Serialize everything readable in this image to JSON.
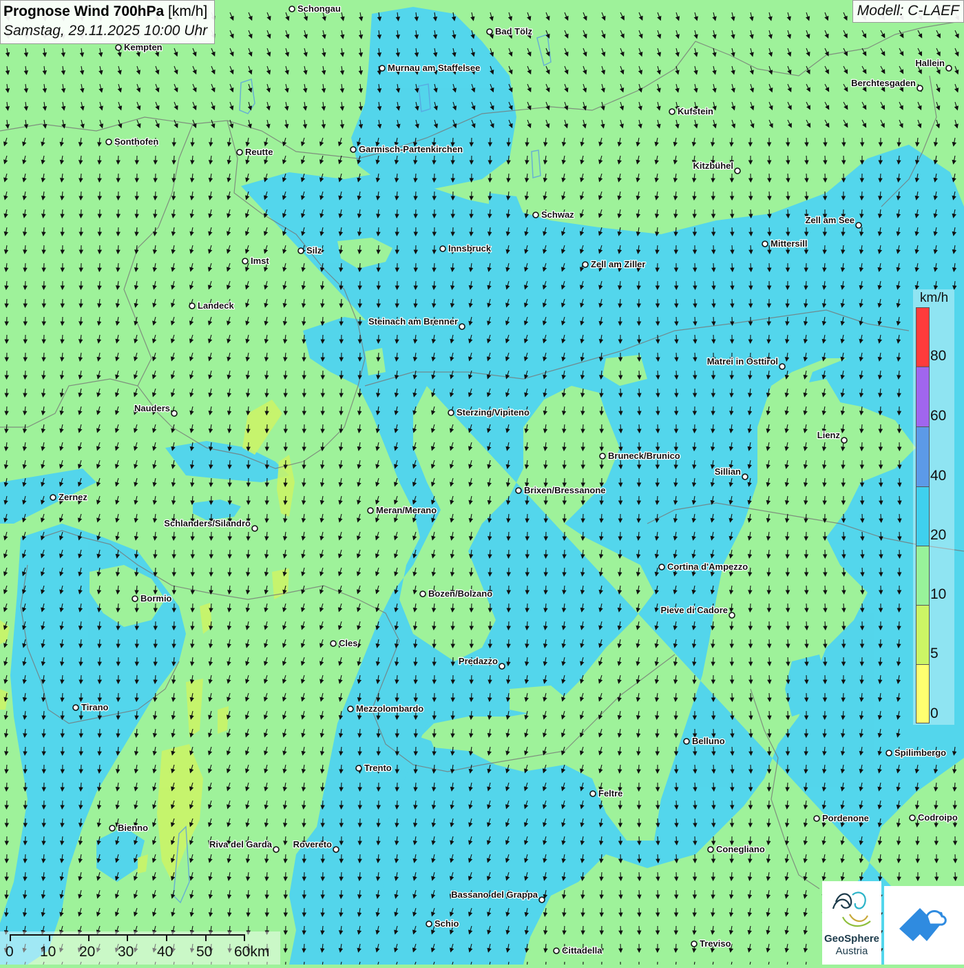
{
  "title": {
    "bold": "Prognose Wind 700hPa",
    "unit": "[km/h]",
    "date": "Samstag, 29.11.2025 10:00 Uhr"
  },
  "model": "Modell: C-LAEF",
  "legend": {
    "unit": "km/h",
    "ticks": [
      "80",
      "60",
      "40",
      "20",
      "10",
      "5",
      "0"
    ],
    "colors": [
      "#ff3b3b",
      "#a066ee",
      "#5c9ae8",
      "#3fd0ee",
      "#98f39a",
      "#ccf565",
      "#ffff70"
    ]
  },
  "scale_bar": {
    "labels": [
      "0",
      "10",
      "20",
      "30",
      "40",
      "50",
      "60km"
    ]
  },
  "wind": {
    "direction": "from north-northwest",
    "speed_classes_visible": [
      "5-10",
      "10-20",
      "20-40"
    ]
  },
  "cities": [
    {
      "name": "Schongau"
    },
    {
      "name": "Bad Tölz"
    },
    {
      "name": "Kempten"
    },
    {
      "name": "Murnau am Staffelsee"
    },
    {
      "name": "Hallein"
    },
    {
      "name": "Berchtesgaden"
    },
    {
      "name": "Kufstein"
    },
    {
      "name": "Sonthofen"
    },
    {
      "name": "Reutte"
    },
    {
      "name": "Garmisch-Partenkirchen"
    },
    {
      "name": "Kitzbühel"
    },
    {
      "name": "Schwaz"
    },
    {
      "name": "Zell am See"
    },
    {
      "name": "Innsbruck"
    },
    {
      "name": "Silz"
    },
    {
      "name": "Mittersill"
    },
    {
      "name": "Imst"
    },
    {
      "name": "Zell am Ziller"
    },
    {
      "name": "Landeck"
    },
    {
      "name": "Steinach am Brenner"
    },
    {
      "name": "Matrei in Osttirol"
    },
    {
      "name": "Nauders"
    },
    {
      "name": "Sterzing/Vipiteno"
    },
    {
      "name": "Lienz"
    },
    {
      "name": "Bruneck/Brunico"
    },
    {
      "name": "Sillian"
    },
    {
      "name": "Brixen/Bressanone"
    },
    {
      "name": "Zernez"
    },
    {
      "name": "Meran/Merano"
    },
    {
      "name": "Schlanders/Silandro"
    },
    {
      "name": "Cortina d'Ampezzo"
    },
    {
      "name": "Bozen/Bolzano"
    },
    {
      "name": "Bormio"
    },
    {
      "name": "Pieve di Cadore"
    },
    {
      "name": "Cles"
    },
    {
      "name": "Predazzo"
    },
    {
      "name": "Tirano"
    },
    {
      "name": "Mezzolombardo"
    },
    {
      "name": "Belluno"
    },
    {
      "name": "Spilimbergo"
    },
    {
      "name": "Trento"
    },
    {
      "name": "Feltre"
    },
    {
      "name": "Pordenone"
    },
    {
      "name": "Codroipo"
    },
    {
      "name": "Bienno"
    },
    {
      "name": "Riva del Garda"
    },
    {
      "name": "Rovereto"
    },
    {
      "name": "Conegliano"
    },
    {
      "name": "Bassano del Grappa"
    },
    {
      "name": "Schio"
    },
    {
      "name": "Treviso"
    },
    {
      "name": "Cittadella"
    }
  ],
  "logos": {
    "geosphere_line1": "GeoSphere",
    "geosphere_line2": "Austria"
  }
}
